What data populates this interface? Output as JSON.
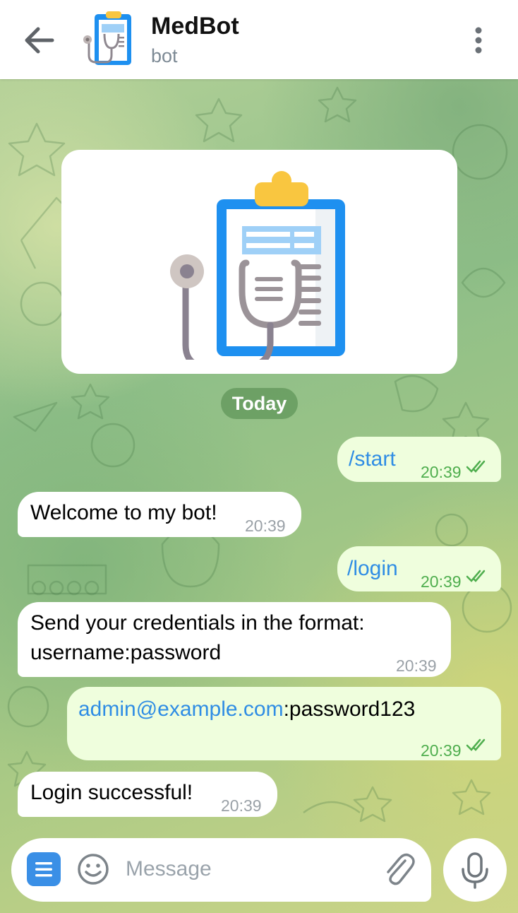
{
  "header": {
    "title": "MedBot",
    "subtitle": "bot"
  },
  "chat": {
    "date_label": "Today",
    "messages": [
      {
        "dir": "out",
        "text": "/start",
        "time": "20:39"
      },
      {
        "dir": "in",
        "text": "Welcome to my bot!",
        "time": "20:39"
      },
      {
        "dir": "out",
        "text": "/login",
        "time": "20:39"
      },
      {
        "dir": "in",
        "line1": "Send your credentials in the format:",
        "line2": "username:password",
        "time": "20:39"
      },
      {
        "dir": "out",
        "link": "admin@example.com",
        "rest": ":password123",
        "time": "20:39"
      },
      {
        "dir": "in",
        "text": "Login successful!",
        "time": "20:39"
      }
    ]
  },
  "composer": {
    "placeholder": "Message"
  },
  "colors": {
    "accent": "#3a8fe6",
    "outgoing_bubble": "#effedd",
    "check_green": "#4fae4e"
  },
  "icons": [
    "back-arrow-icon",
    "medbot-avatar-icon",
    "more-vertical-icon",
    "bot-menu-icon",
    "emoji-icon",
    "paperclip-icon",
    "microphone-icon",
    "double-check-icon"
  ]
}
